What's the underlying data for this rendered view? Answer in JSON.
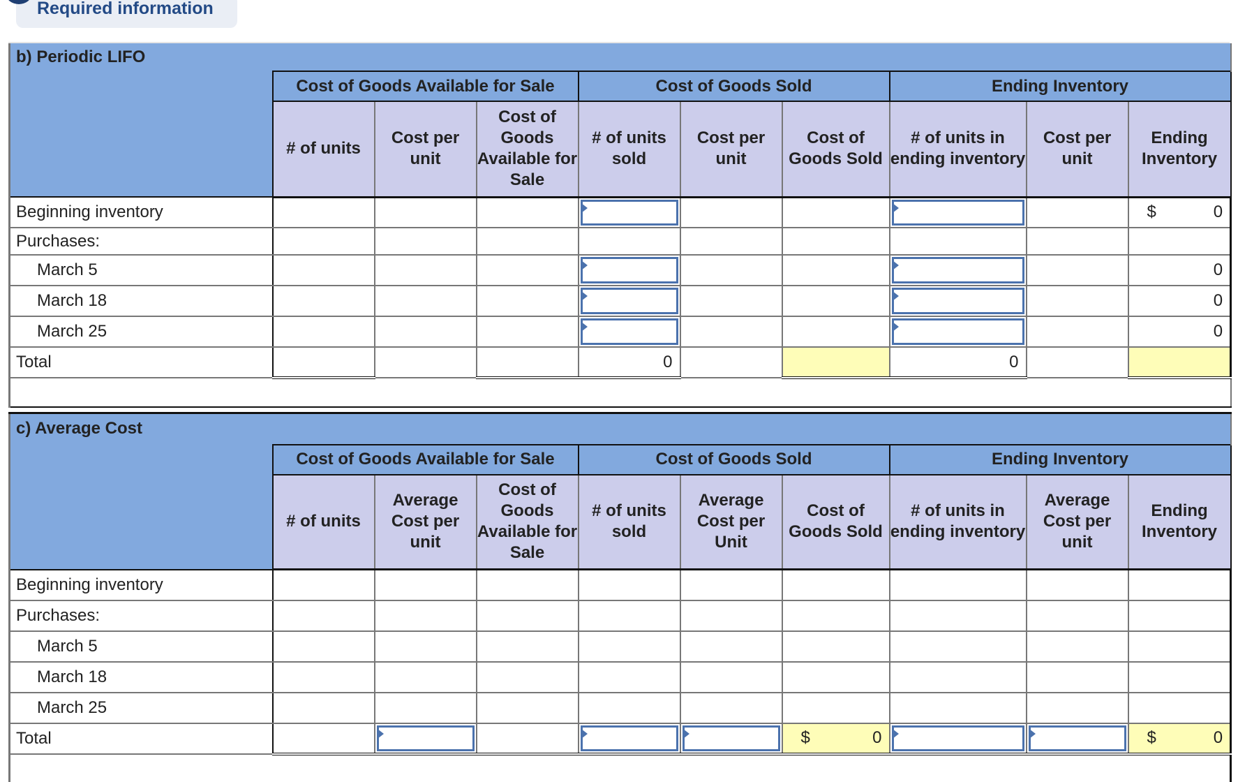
{
  "banner": {
    "label": "Required information"
  },
  "sections": [
    {
      "title": "b) Periodic LIFO",
      "groups": [
        "Cost of Goods Available for Sale",
        "Cost of Goods Sold",
        "Ending Inventory"
      ],
      "columns": [
        "# of units",
        "Cost per unit",
        "Cost of Goods Available for Sale",
        "# of units sold",
        "Cost per unit",
        "Cost of Goods Sold",
        "# of units in ending inventory",
        "Cost per unit",
        "Ending Inventory"
      ],
      "rows": [
        {
          "label": "Beginning inventory",
          "cells": [
            "",
            "",
            "",
            "",
            "",
            "",
            "",
            "",
            "0"
          ],
          "ending_prefix": "$"
        },
        {
          "label": "Purchases:",
          "cells": [
            "",
            "",
            "",
            "",
            "",
            "",
            "",
            "",
            ""
          ]
        },
        {
          "label": "March 5",
          "cells": [
            "",
            "",
            "",
            "",
            "",
            "",
            "",
            "",
            "0"
          ]
        },
        {
          "label": "March 18",
          "cells": [
            "",
            "",
            "",
            "",
            "",
            "",
            "",
            "",
            "0"
          ]
        },
        {
          "label": "March 25",
          "cells": [
            "",
            "",
            "",
            "",
            "",
            "",
            "",
            "",
            "0"
          ]
        },
        {
          "label": "Total",
          "cells": [
            "",
            "",
            "",
            "0",
            "",
            "",
            "0",
            "",
            ""
          ]
        }
      ]
    },
    {
      "title": "c) Average Cost",
      "groups": [
        "Cost of Goods Available for Sale",
        "Cost of Goods Sold",
        "Ending Inventory"
      ],
      "columns": [
        "# of units",
        "Average Cost per unit",
        "Cost of Goods Available for Sale",
        "# of units sold",
        "Average Cost per Unit",
        "Cost of Goods Sold",
        "# of units in ending inventory",
        "Average Cost per unit",
        "Ending Inventory"
      ],
      "rows": [
        {
          "label": "Beginning inventory",
          "cells": [
            "",
            "",
            "",
            "",
            "",
            "",
            "",
            "",
            ""
          ]
        },
        {
          "label": "Purchases:",
          "cells": [
            "",
            "",
            "",
            "",
            "",
            "",
            "",
            "",
            ""
          ]
        },
        {
          "label": "March 5",
          "cells": [
            "",
            "",
            "",
            "",
            "",
            "",
            "",
            "",
            ""
          ]
        },
        {
          "label": "March 18",
          "cells": [
            "",
            "",
            "",
            "",
            "",
            "",
            "",
            "",
            ""
          ]
        },
        {
          "label": "March 25",
          "cells": [
            "",
            "",
            "",
            "",
            "",
            "",
            "",
            "",
            ""
          ]
        },
        {
          "label": "Total",
          "cells": [
            "",
            "",
            "",
            "",
            "",
            "0",
            "",
            "",
            "0"
          ],
          "cogs_prefix": "$",
          "ending_prefix": "$"
        }
      ]
    }
  ],
  "colors": {
    "title_bg": "#82a9de",
    "subheader_bg": "#cccdeb",
    "highlight": "#fefdb8",
    "input_border": "#4b72ad"
  }
}
